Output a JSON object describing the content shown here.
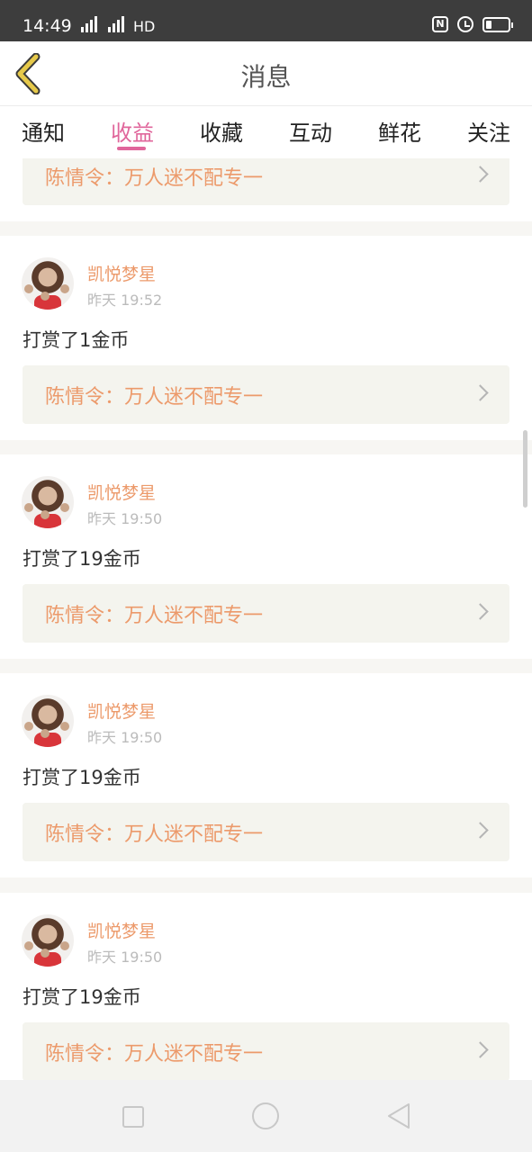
{
  "status_bar": {
    "time": "14:49",
    "network": "HD"
  },
  "header": {
    "title": "消息"
  },
  "tabs": [
    {
      "label": "通知",
      "active": false
    },
    {
      "label": "收益",
      "active": true
    },
    {
      "label": "收藏",
      "active": false
    },
    {
      "label": "互动",
      "active": false
    },
    {
      "label": "鲜花",
      "active": false
    },
    {
      "label": "关注",
      "active": false
    }
  ],
  "partial_item": {
    "link_text": "陈情令：万人迷不配专一"
  },
  "items": [
    {
      "name": "凯悦梦星",
      "time": "昨天 19:52",
      "message": "打赏了1金币",
      "link_text": "陈情令：万人迷不配专一"
    },
    {
      "name": "凯悦梦星",
      "time": "昨天 19:50",
      "message": "打赏了19金币",
      "link_text": "陈情令：万人迷不配专一"
    },
    {
      "name": "凯悦梦星",
      "time": "昨天 19:50",
      "message": "打赏了19金币",
      "link_text": "陈情令：万人迷不配专一"
    },
    {
      "name": "凯悦梦星",
      "time": "昨天 19:50",
      "message": "打赏了19金币",
      "link_text": "陈情令：万人迷不配专一"
    }
  ],
  "colors": {
    "accent": "#e0669b",
    "name": "#ec9a6b",
    "link_bg": "#f4f4ee",
    "back_arrow": "#e6c94a"
  }
}
